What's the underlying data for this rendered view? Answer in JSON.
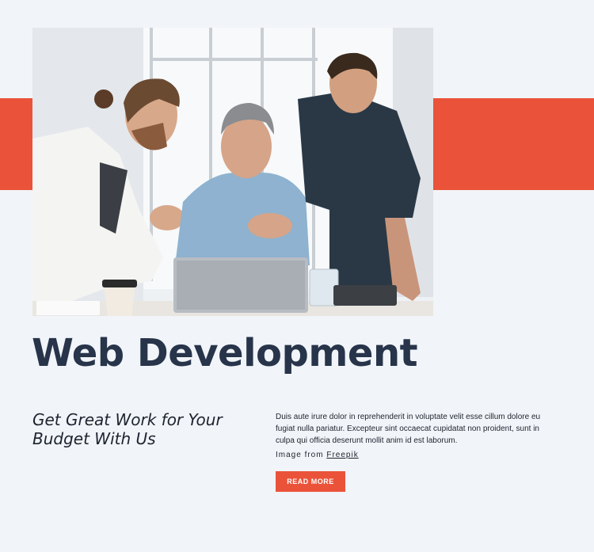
{
  "hero": {
    "image_alt_colors": {
      "accent": "#ea533a",
      "dark": "#27344a"
    }
  },
  "heading": "Web Development",
  "subheading": "Get Great Work for Your Budget With Us",
  "description": "Duis aute irure dolor in reprehenderit in voluptate velit esse cillum dolore eu fugiat nulla pariatur. Excepteur sint occaecat cupidatat non proident, sunt in culpa qui officia deserunt mollit anim id est laborum.",
  "credit": {
    "prefix": "Image from",
    "link_label": "Freepik"
  },
  "cta": {
    "label": "READ MORE"
  }
}
